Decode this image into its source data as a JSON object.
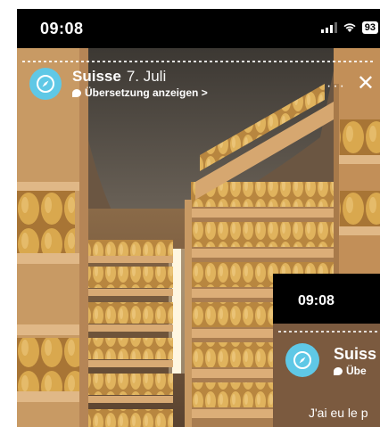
{
  "status_bar": {
    "time": "09:08",
    "battery": "93",
    "icons": [
      "signal-icon",
      "wifi-icon",
      "battery-icon"
    ]
  },
  "story": {
    "account": "Suisse",
    "date": "7. Juli",
    "translate_label": "Übersetzung anzeigen >",
    "more_label": "···",
    "close_label": "✕"
  },
  "overlay": {
    "time": "09:08",
    "account": "Suiss",
    "translate_label": "Übe",
    "caption": "J'ai eu le p"
  },
  "colors": {
    "avatar": "#5fc8e6",
    "wood": "#c89a64",
    "cheese": "#d9a84e"
  }
}
